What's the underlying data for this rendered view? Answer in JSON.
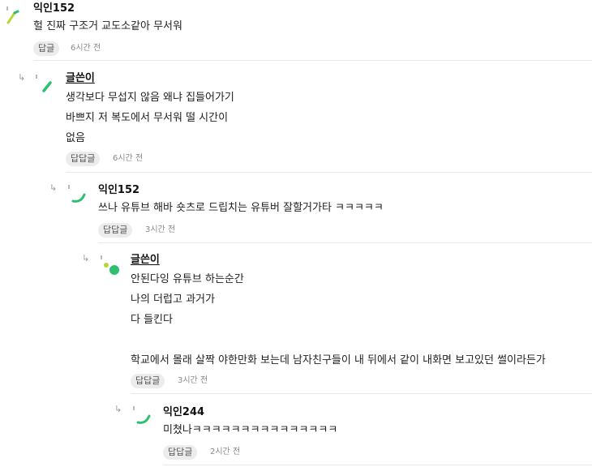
{
  "comments": [
    {
      "author": "익인152",
      "lines": [
        "헐 진짜 구조거 교도소같아 무서워"
      ],
      "reply_label": "답글",
      "time": "6시간 전",
      "avatar_icon": "green-doodle-avatar-icon"
    },
    {
      "author": "글쓴이",
      "lines": [
        "생각보다 무섭지 않음 왜냐 집들어가기",
        "바쁘지 저 복도에서 무서워 떨 시간이",
        "없음"
      ],
      "reply_label": "답답글",
      "time": "6시간 전",
      "avatar_icon": "green-doodle-avatar-icon"
    },
    {
      "author": "익인152",
      "lines": [
        "쓰나 유튜브 해바 숏츠로 드립치는 유튜버 잘할거가타 ㅋㅋㅋㅋㅋ"
      ],
      "reply_label": "답답글",
      "time": "3시간 전",
      "avatar_icon": "green-doodle-avatar-icon"
    },
    {
      "author": "글쓴이",
      "lines": [
        "안된다잉 유튜브 하는순간",
        "나의 더럽고 과거가",
        "다 들킨다",
        "",
        "학교에서 몰래 살짝 야한만화 보는데 남자친구들이 내 뒤에서 같이 내화면 보고있던 썰이라든가"
      ],
      "reply_label": "답답글",
      "time": "3시간 전",
      "avatar_icon": "green-dot-avatar-icon"
    },
    {
      "author": "익인244",
      "lines": [
        "미쳤나ㅋㅋㅋㅋㅋㅋㅋㅋㅋㅋㅋㅋㅋㅋㅋ"
      ],
      "reply_label": "답답글",
      "time": "2시간 전",
      "avatar_icon": "green-doodle-avatar-icon"
    }
  ],
  "colors": {
    "accent": "#2fbf71",
    "lime": "#b7d63a",
    "divider": "#e9e9e9"
  },
  "reply_arrow_icon": "reply-arrow-icon"
}
